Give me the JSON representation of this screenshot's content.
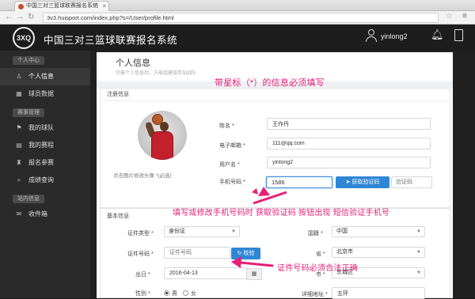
{
  "browser": {
    "tab_title": "中国三对三篮球联赛报名系统",
    "url": "3v3.huisport.com/index.php?s=/User/profile.html"
  },
  "header": {
    "logo_text": "3XQ",
    "site_title": "中国三对三篮球联赛报名系统",
    "username": "yinlong2"
  },
  "sidebar": {
    "groups": [
      {
        "label": "个人中心",
        "items": [
          {
            "label": "个人信息",
            "icon": "person-icon"
          },
          {
            "label": "球员数据",
            "icon": "grid-icon"
          }
        ]
      },
      {
        "label": "赛事管理",
        "items": [
          {
            "label": "我的球队",
            "icon": "team-icon"
          },
          {
            "label": "我的赛程",
            "icon": "schedule-icon"
          },
          {
            "label": "报名参赛",
            "icon": "trophy-icon"
          },
          {
            "label": "成绩查询",
            "icon": "search-icon"
          }
        ]
      },
      {
        "label": "站内信息",
        "items": [
          {
            "label": "收件箱",
            "icon": "mail-icon"
          }
        ]
      }
    ]
  },
  "page": {
    "title": "个人信息",
    "subtitle": "完善个人信息后，方能组建或参加战队"
  },
  "annotations": {
    "required_note": "带星标（*）的信息必须填写",
    "phone_note": "填写或修改手机号码时 获取验证码 按钮出现  短信验证手机号",
    "id_note": "证件号码必须合法正确"
  },
  "registration": {
    "header": "注册信息",
    "avatar_caption": "点击图片修改头像 *(必选)",
    "name_label": "姓名 *",
    "name_value": "王作丹",
    "email_label": "电子邮箱 *",
    "email_value": "111@qq.com",
    "user_label": "用户名 *",
    "user_value": "yinlong2",
    "phone_label": "手机号码 *",
    "phone_value": "1586",
    "sms_button": "获取验证码",
    "sms_placeholder": "验证码"
  },
  "basic": {
    "header": "基本信息",
    "id_type_label": "证件类型 *",
    "id_type_value": "身份证",
    "id_number_label": "证件号码 *",
    "id_number_placeholder": "证件号码",
    "verify_button": "校验",
    "birth_label": "出日 *",
    "birth_value": "2016-04-13",
    "gender_label": "性别 *",
    "gender_male": "男",
    "gender_female": "女",
    "country_label": "国籍 *",
    "country_value": "中国",
    "province_label": "省 *",
    "province_value": "北京市",
    "city_label": "市 *",
    "city_value": "东城区",
    "address_label": "详细地址 *",
    "address_value": "五环"
  },
  "colors": {
    "accent": "#2f86d6",
    "annotation": "#e91e75"
  }
}
